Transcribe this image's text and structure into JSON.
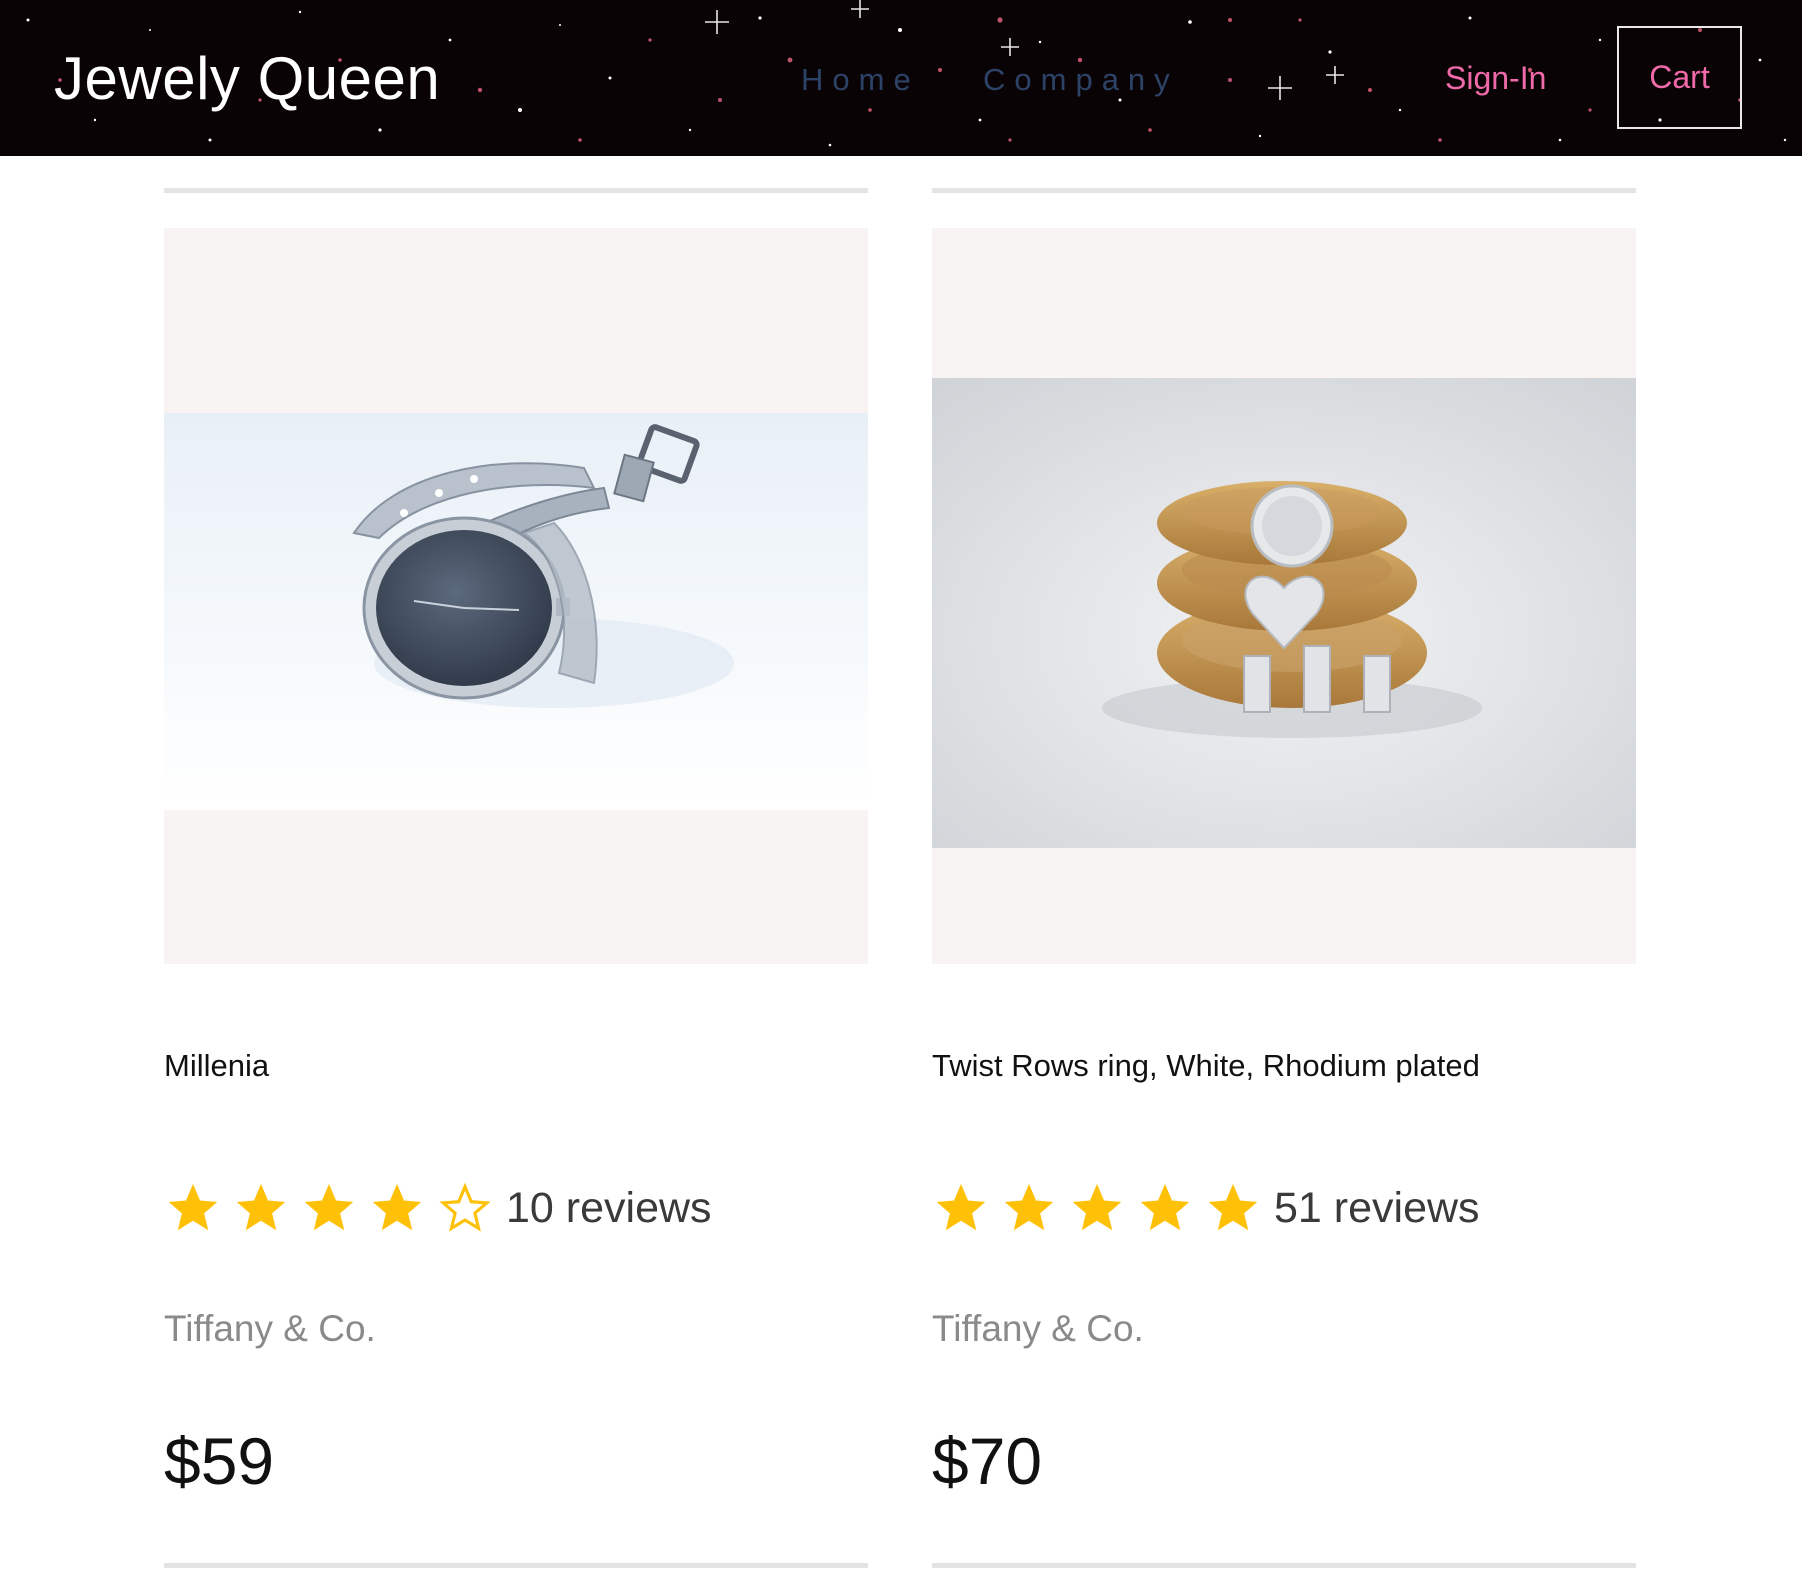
{
  "header": {
    "logo": "Jewely Queen",
    "nav": [
      {
        "label": "Home"
      },
      {
        "label": "Company"
      }
    ],
    "signin_label": "Sign-In",
    "cart_label": "Cart"
  },
  "products": [
    {
      "title": "Millenia",
      "image_icon": "watch-photo",
      "rating": 4,
      "rating_max": 5,
      "reviews": "10 reviews",
      "brand": "Tiffany & Co.",
      "price": "$59"
    },
    {
      "title": "Twist Rows ring, White, Rhodium plated",
      "image_icon": "ring-photo",
      "rating": 5,
      "rating_max": 5,
      "reviews": "51 reviews",
      "brand": "Tiffany & Co.",
      "price": "$70"
    }
  ],
  "colors": {
    "header_bg": "#0a0305",
    "nav_link": "#2c4266",
    "accent_pink": "#f06aa9",
    "star_gold": "#ffc107",
    "image_bg": "#f7f4f3"
  }
}
